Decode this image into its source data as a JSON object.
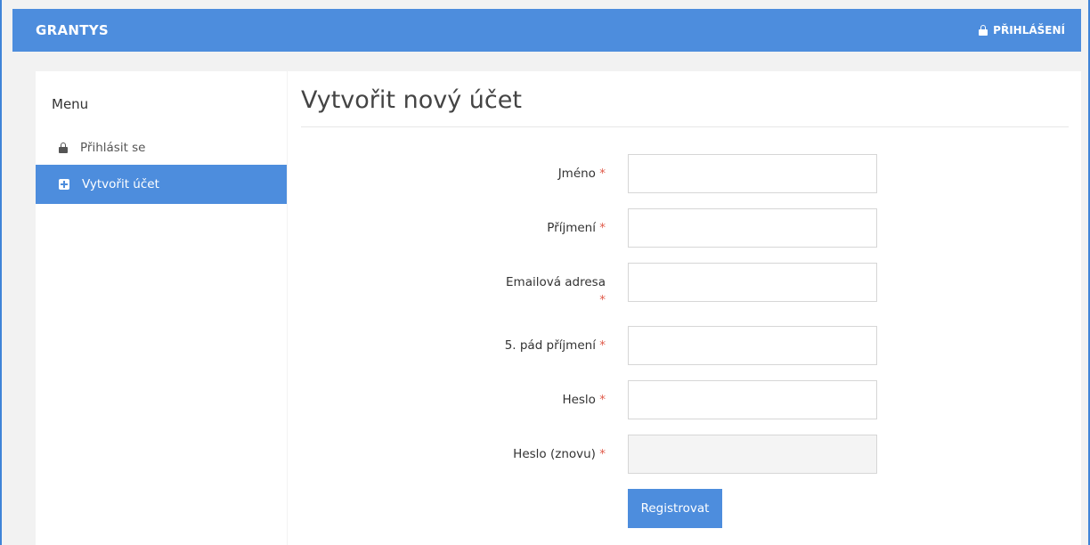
{
  "navbar": {
    "brand": "GRANTYS",
    "login_label": "PŘIHLÁŠENÍ"
  },
  "sidebar": {
    "title": "Menu",
    "items": [
      {
        "label": "Přihlásit se",
        "icon": "lock-icon"
      },
      {
        "label": "Vytvořit účet",
        "icon": "plus-square-icon",
        "active": true
      }
    ]
  },
  "page": {
    "title": "Vytvořit nový účet"
  },
  "form": {
    "required_mark": "*",
    "fields": [
      {
        "label": "Jméno",
        "value": ""
      },
      {
        "label": "Příjmení",
        "value": ""
      },
      {
        "label": "Emailová adresa",
        "value": ""
      },
      {
        "label": "5. pád příjmení",
        "value": ""
      },
      {
        "label": "Heslo",
        "value": ""
      },
      {
        "label": "Heslo (znovu)",
        "value": ""
      }
    ],
    "submit_label": "Registrovat"
  },
  "colors": {
    "primary": "#4d8ddd",
    "required": "#e05a4a",
    "background": "#f2f2f2"
  }
}
